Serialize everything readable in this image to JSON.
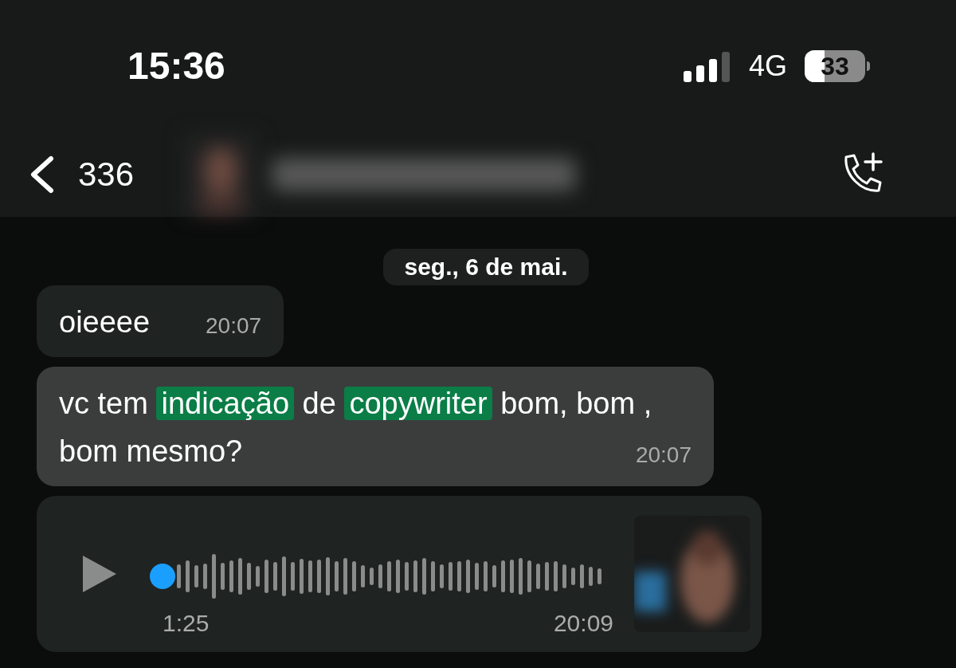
{
  "status_bar": {
    "time": "15:36",
    "network": "4G",
    "battery": {
      "label": "33",
      "level": 0.33
    }
  },
  "header": {
    "back_count": "336"
  },
  "date_chip": "seg., 6 de mai.",
  "messages": [
    {
      "kind": "text",
      "selected": false,
      "segments": [
        {
          "text": "oieeee",
          "highlighted": false
        }
      ],
      "time": "20:07"
    },
    {
      "kind": "text",
      "selected": true,
      "segments": [
        {
          "text": "vc tem ",
          "highlighted": false
        },
        {
          "text": "indicação",
          "highlighted": true
        },
        {
          "text": " de ",
          "highlighted": false
        },
        {
          "text": "copywriter",
          "highlighted": true
        },
        {
          "text": " bom, bom , bom mesmo?",
          "highlighted": false
        }
      ],
      "time": "20:07"
    },
    {
      "kind": "voice",
      "selected": false,
      "duration": "1:25",
      "time": "20:09"
    }
  ]
}
